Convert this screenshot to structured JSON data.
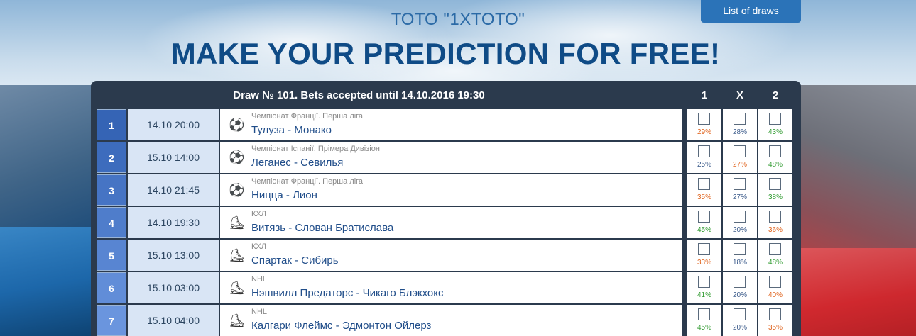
{
  "header": {
    "toto_title": "ТОТО \"1XТОТО\"",
    "main_title": "MAKE YOUR PREDICTION FOR FREE!",
    "list_of_draws": "List of draws"
  },
  "panel": {
    "draw_info": "Draw № 101. Bets accepted until 14.10.2016 19:30",
    "col_1": "1",
    "col_x": "X",
    "col_2": "2"
  },
  "colors": {
    "low": "#3a5a8a",
    "high_orange": "#e0641e",
    "green": "#2e9a2e"
  },
  "rows": [
    {
      "num": "1",
      "time": "14.10 20:00",
      "icon": "soccer-ball-icon",
      "league": "Чемпіонат Франції. Перша ліга",
      "match": "Тулуза - Монако",
      "p1": "29%",
      "px": "28%",
      "p2": "43%",
      "c1": "orange",
      "cx": "blue",
      "c2": "green"
    },
    {
      "num": "2",
      "time": "15.10 14:00",
      "icon": "soccer-ball-icon",
      "league": "Чемпіонат Іспанії. Прімера Дивізіон",
      "match": "Леганес - Севилья",
      "p1": "25%",
      "px": "27%",
      "p2": "48%",
      "c1": "blue",
      "cx": "orange",
      "c2": "green"
    },
    {
      "num": "3",
      "time": "14.10 21:45",
      "icon": "soccer-ball-icon",
      "league": "Чемпіонат Франції. Перша ліга",
      "match": "Ницца - Лион",
      "p1": "35%",
      "px": "27%",
      "p2": "38%",
      "c1": "orange",
      "cx": "blue",
      "c2": "green"
    },
    {
      "num": "4",
      "time": "14.10 19:30",
      "icon": "hockey-skate-icon",
      "league": "КХЛ",
      "match": "Витязь - Слован Братислава",
      "p1": "45%",
      "px": "20%",
      "p2": "36%",
      "c1": "green",
      "cx": "blue",
      "c2": "orange"
    },
    {
      "num": "5",
      "time": "15.10 13:00",
      "icon": "hockey-skate-icon",
      "league": "КХЛ",
      "match": "Спартак - Сибирь",
      "p1": "33%",
      "px": "18%",
      "p2": "48%",
      "c1": "orange",
      "cx": "blue",
      "c2": "green"
    },
    {
      "num": "6",
      "time": "15.10 03:00",
      "icon": "hockey-skate-icon",
      "league": "NHL",
      "match": "Нэшвилл Предаторс - Чикаго Блэкхокс",
      "p1": "41%",
      "px": "20%",
      "p2": "40%",
      "c1": "green",
      "cx": "blue",
      "c2": "orange"
    },
    {
      "num": "7",
      "time": "15.10 04:00",
      "icon": "hockey-skate-icon",
      "league": "NHL",
      "match": "Калгари Флеймс - Эдмонтон Ойлерз",
      "p1": "45%",
      "px": "20%",
      "p2": "35%",
      "c1": "green",
      "cx": "blue",
      "c2": "orange"
    }
  ]
}
